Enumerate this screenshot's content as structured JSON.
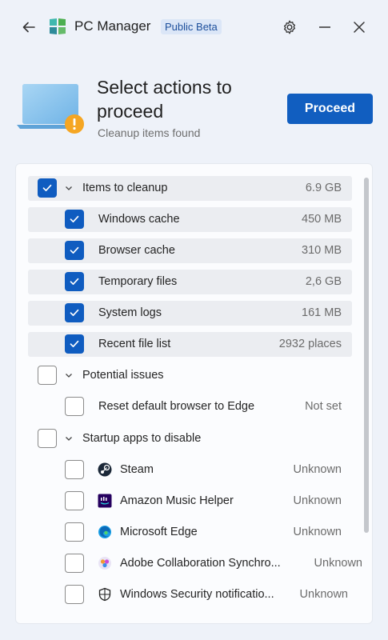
{
  "window": {
    "title": "PC Manager",
    "badge": "Public Beta"
  },
  "header": {
    "headline_line1": "Select actions to",
    "headline_line2": "proceed",
    "subtitle": "Cleanup items found",
    "proceed_label": "Proceed"
  },
  "colors": {
    "accent": "#115ec0",
    "warning": "#f5a623",
    "background": "#eef2f9"
  },
  "groups": {
    "cleanup": {
      "label": "Items to cleanup",
      "size": "6.9 GB",
      "checked": true,
      "items": [
        {
          "label": "Windows cache",
          "value": "450 MB",
          "checked": true
        },
        {
          "label": "Browser cache",
          "value": "310 MB",
          "checked": true
        },
        {
          "label": "Temporary files",
          "value": "2,6 GB",
          "checked": true
        },
        {
          "label": "System logs",
          "value": "161 MB",
          "checked": true
        },
        {
          "label": "Recent file list",
          "value": "2932 places",
          "checked": true
        }
      ]
    },
    "issues": {
      "label": "Potential issues",
      "checked": false,
      "items": [
        {
          "label": "Reset default browser to Edge",
          "value": "Not set",
          "checked": false
        }
      ]
    },
    "startup": {
      "label": "Startup apps to disable",
      "checked": false,
      "items": [
        {
          "label": "Steam",
          "value": "Unknown",
          "icon": "steam-icon",
          "checked": false
        },
        {
          "label": "Amazon Music Helper",
          "value": "Unknown",
          "icon": "amazon-music-icon",
          "checked": false
        },
        {
          "label": "Microsoft Edge",
          "value": "Unknown",
          "icon": "edge-icon",
          "checked": false
        },
        {
          "label": "Adobe Collaboration Synchro...",
          "value": "Unknown",
          "icon": "adobe-icon",
          "checked": false
        },
        {
          "label": "Windows Security notificatio...",
          "value": "Unknown",
          "icon": "shield-icon",
          "checked": false
        }
      ]
    }
  }
}
